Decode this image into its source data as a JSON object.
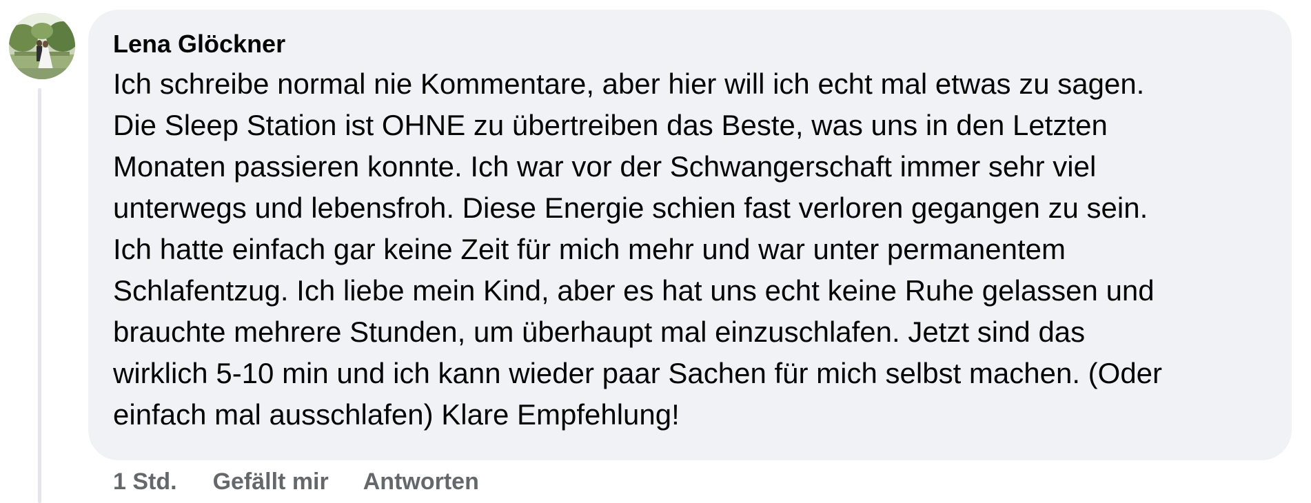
{
  "comment": {
    "author": "Lena Glöckner",
    "avatar_icon": "avatar-photo-icon",
    "lines": [
      "Ich schreibe normal nie Kommentare, aber hier will ich echt mal etwas zu sagen.",
      "Die Sleep Station ist OHNE zu übertreiben das Beste, was uns in den Letzten",
      "Monaten passieren konnte. Ich war vor der Schwangerschaft immer sehr viel",
      "unterwegs und lebensfroh. Diese Energie schien fast verloren gegangen zu sein.",
      "Ich hatte einfach gar keine Zeit für mich mehr und war unter permanentem",
      "Schlafentzug. Ich liebe mein Kind, aber es hat uns echt keine Ruhe gelassen und",
      "brauchte mehrere Stunden, um überhaupt mal einzuschlafen. Jetzt sind das",
      "wirklich 5-10 min und ich kann wieder paar Sachen für mich selbst machen. (Oder",
      "einfach mal ausschlafen) Klare Empfehlung!"
    ]
  },
  "actions": {
    "time": "1 Std.",
    "like": "Gefällt mir",
    "reply": "Antworten"
  },
  "colors": {
    "bubble": "#f0f2f5",
    "text": "#050505",
    "secondary": "#65676b",
    "thread_line": "#e4e6eb"
  }
}
